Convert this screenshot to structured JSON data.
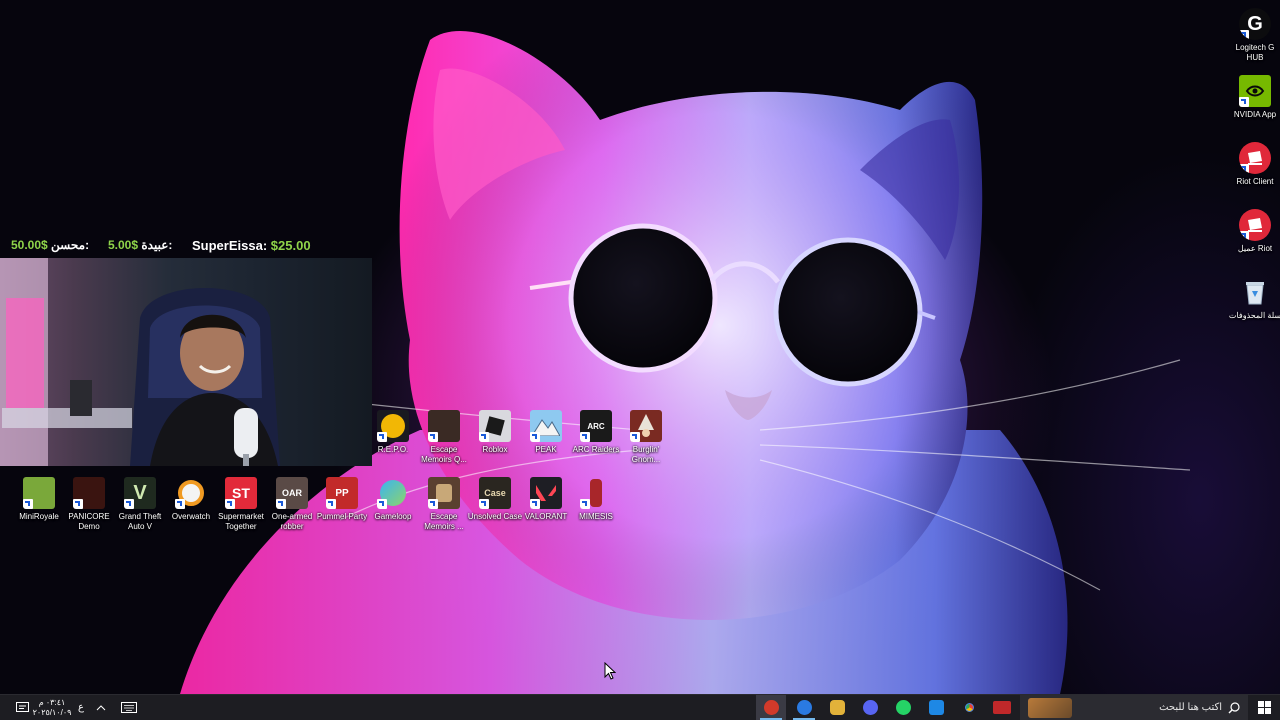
{
  "stream_overlay": {
    "donations": [
      {
        "name": "SuperEissa:",
        "amount": "$25.00"
      },
      {
        "name": "عبيدة:",
        "amount": "5.00$"
      },
      {
        "name": "محسن:",
        "amount": "50.00$"
      }
    ]
  },
  "desktop_icons_right": [
    {
      "label": "Logitech G HUB",
      "icon": "logitech-g-icon"
    },
    {
      "label": "NVIDIA App",
      "icon": "nvidia-icon"
    },
    {
      "label": "Riot Client",
      "icon": "riot-icon"
    },
    {
      "label": "عميل Riot",
      "icon": "riot-icon"
    },
    {
      "label": "سلة المحذوفات",
      "icon": "recycle-bin-icon"
    }
  ],
  "desktop_icons_row1": [
    {
      "label": "R.E.P.O.",
      "icon": "repo-game-icon",
      "color": "#f2b705"
    },
    {
      "label": "Escape Memoirs Q...",
      "icon": "escape-memoirs-icon",
      "color": "#3a2a24"
    },
    {
      "label": "Roblox",
      "icon": "roblox-icon",
      "color": "#d9d9de"
    },
    {
      "label": "PEAK",
      "icon": "peak-icon",
      "color": "#8ec9f0"
    },
    {
      "label": "ARC Raiders",
      "icon": "arc-raiders-icon",
      "color": "#1a1a1a"
    },
    {
      "label": "Burglin' Gnom...",
      "icon": "burglin-gnomes-icon",
      "color": "#7a2a22"
    }
  ],
  "desktop_icons_row2": [
    {
      "label": "MiniRoyale",
      "icon": "miniroyale-icon",
      "color": "#7aa83a"
    },
    {
      "label": "PANICORE Demo",
      "icon": "panicore-icon",
      "color": "#3a1410"
    },
    {
      "label": "Grand Theft Auto V",
      "icon": "gta-v-icon",
      "color": "#1f2a1f"
    },
    {
      "label": "Overwatch",
      "icon": "overwatch-icon",
      "color": "#f09a22"
    },
    {
      "label": "Supermarket Together",
      "icon": "supermarket-together-icon",
      "color": "#e22a3a"
    },
    {
      "label": "One-armed robber",
      "icon": "one-armed-robber-icon",
      "color": "#5a4a46"
    },
    {
      "label": "Pummel Party",
      "icon": "pummel-party-icon",
      "color": "#c22a2a"
    },
    {
      "label": "Gameloop",
      "icon": "gameloop-icon",
      "color": "#3ab4f2"
    },
    {
      "label": "Escape Memoirs ...",
      "icon": "escape-memoirs-icon",
      "color": "#5a4030"
    },
    {
      "label": "Unsolved Case",
      "icon": "unsolved-case-icon",
      "color": "#2a2620"
    },
    {
      "label": "VALORANT",
      "icon": "valorant-icon",
      "color": "#1e1e24"
    },
    {
      "label": "MIMESIS",
      "icon": "mimesis-icon",
      "color": "#a8262a"
    }
  ],
  "taskbar": {
    "search_placeholder": "اكتب هنا للبحث",
    "time": "٠٣:٤١ م",
    "date": "٢٠٢٥/١٠/٠٩",
    "language": "ع",
    "apps": [
      {
        "name": "app-red-icon",
        "color": "#d23a2a",
        "active": true
      },
      {
        "name": "app-blue-icon",
        "color": "#2a7ae2",
        "active": true
      },
      {
        "name": "app-yellow-icon",
        "color": "#e2b23a",
        "active": false
      },
      {
        "name": "discord-icon",
        "color": "#5865f2",
        "active": false
      },
      {
        "name": "whatsapp-icon",
        "color": "#25d366",
        "active": false
      },
      {
        "name": "mail-icon",
        "color": "#1e88e5",
        "active": false
      },
      {
        "name": "chrome-icon",
        "color": "#34a853",
        "active": false
      },
      {
        "name": "app-news-icon",
        "color": "#c0282a",
        "active": false
      }
    ]
  }
}
